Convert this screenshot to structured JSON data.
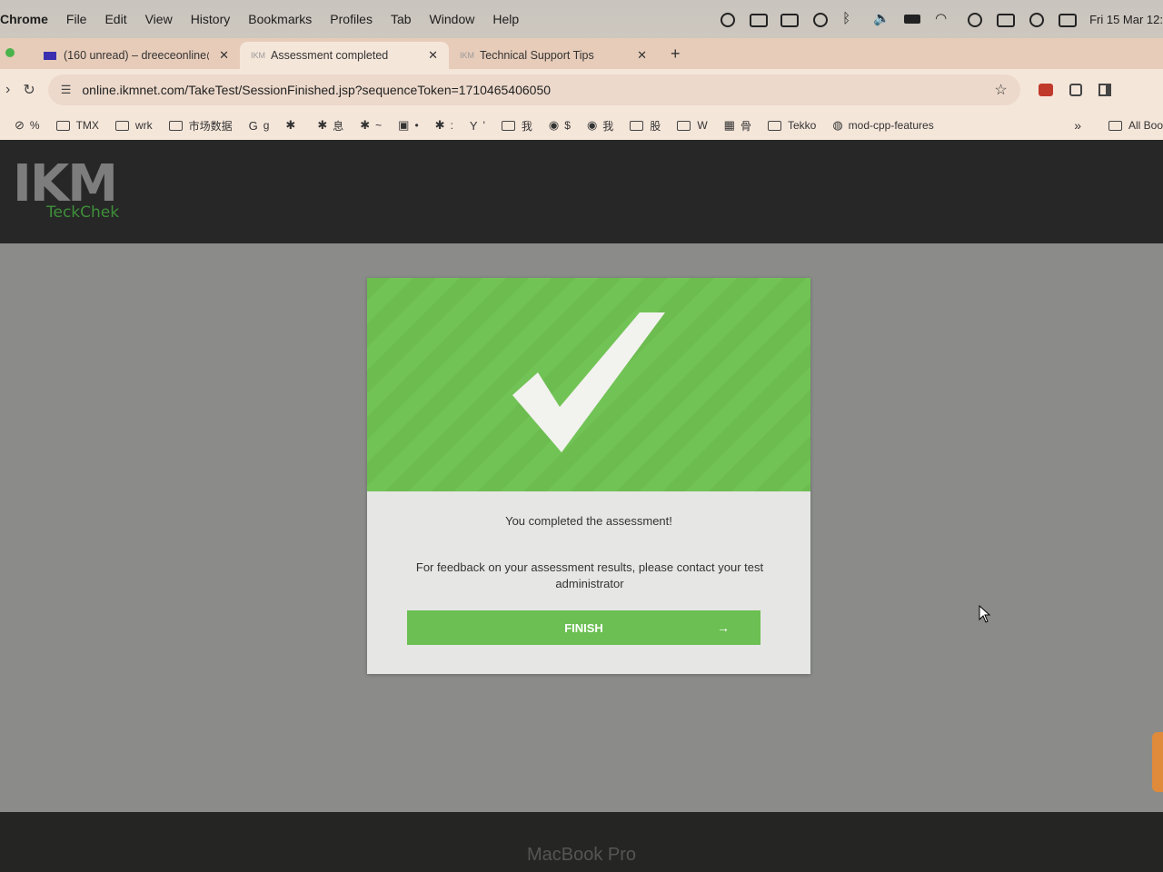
{
  "menubar": {
    "app": "Chrome",
    "items": [
      "File",
      "Edit",
      "View",
      "History",
      "Bookmarks",
      "Profiles",
      "Tab",
      "Window",
      "Help"
    ],
    "clock": "Fri 15 Mar 12:"
  },
  "tabs": [
    {
      "title": "(160 unread) – dreeceonline@",
      "active": false
    },
    {
      "title": "Assessment completed",
      "active": true
    },
    {
      "title": "Technical Support Tips",
      "active": false
    }
  ],
  "toolbar": {
    "url": "online.ikmnet.com/TakeTest/SessionFinished.jsp?sequenceToken=1710465406050"
  },
  "bookmarks": [
    {
      "icon": "no-entry-icon",
      "label": "%"
    },
    {
      "icon": "folder-icon",
      "label": "TMX"
    },
    {
      "icon": "folder-icon",
      "label": "wrk"
    },
    {
      "icon": "folder-icon",
      "label": "市场数据"
    },
    {
      "icon": "google-icon",
      "label": "g"
    },
    {
      "icon": "site-icon",
      "label": ""
    },
    {
      "icon": "site-icon",
      "label": "息"
    },
    {
      "icon": "site-icon",
      "label": "~"
    },
    {
      "icon": "tc-icon",
      "label": "•"
    },
    {
      "icon": "site-icon",
      "label": ":"
    },
    {
      "icon": "yahoo-icon",
      "label": "'"
    },
    {
      "icon": "folder-icon",
      "label": "我"
    },
    {
      "icon": "globe-icon",
      "label": "$"
    },
    {
      "icon": "globe-icon",
      "label": "我"
    },
    {
      "icon": "folder-icon",
      "label": "股"
    },
    {
      "icon": "folder-icon",
      "label": "W"
    },
    {
      "icon": "grid-icon",
      "label": "骨"
    },
    {
      "icon": "folder-icon",
      "label": "Tekko"
    },
    {
      "icon": "github-icon",
      "label": "mod-cpp-features"
    }
  ],
  "bookmarks_more": "»",
  "bookmarks_all": "All Boo",
  "page": {
    "logo_main": "IKM",
    "logo_sub": "TeckChek",
    "completed_message": "You completed the assessment!",
    "feedback_message": "For feedback on your assessment results, please contact your test administrator",
    "finish_label": "FINISH",
    "finish_arrow": "→"
  },
  "device_label": "MacBook Pro",
  "colors": {
    "banner_green": "#6fc253",
    "button_green": "#6cbf52",
    "header_dark": "#262726",
    "page_gray": "#8b8c8a"
  }
}
